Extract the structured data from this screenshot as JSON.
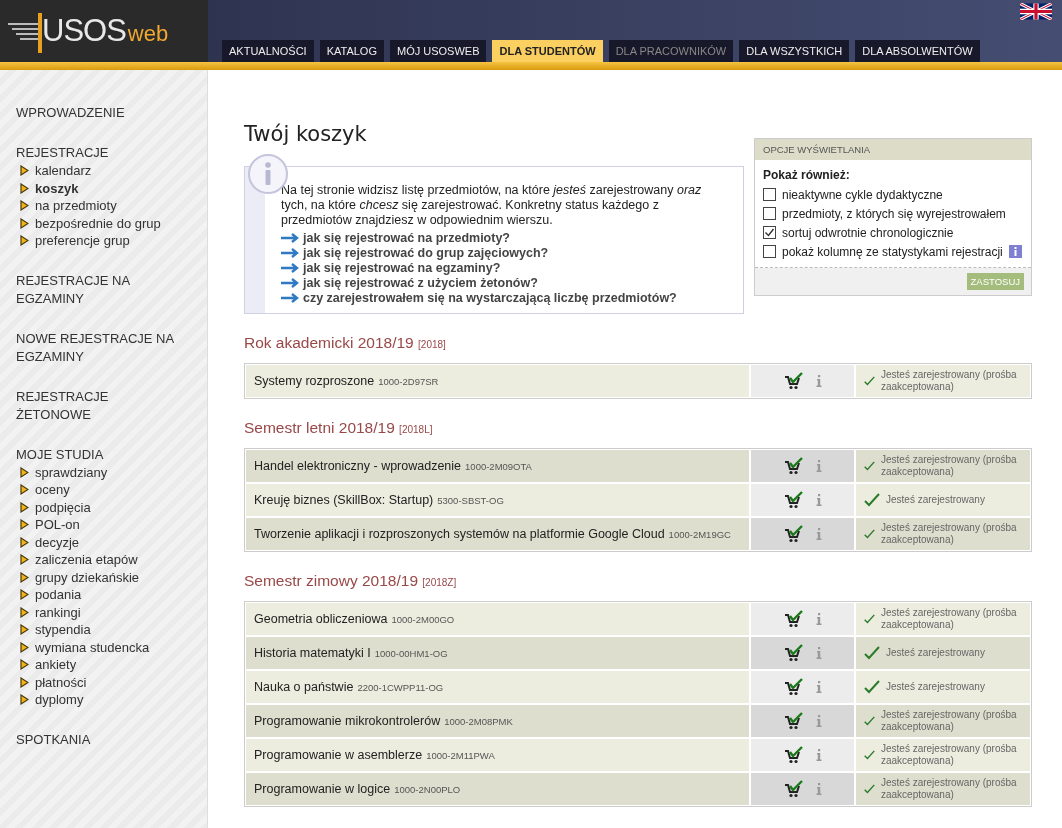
{
  "logo": {
    "main": "USOS",
    "suffix": "web"
  },
  "nav_tabs": [
    {
      "label": "AKTUALNOŚCI",
      "selected": false,
      "disabled": false
    },
    {
      "label": "KATALOG",
      "selected": false,
      "disabled": false
    },
    {
      "label": "MÓJ USOSWEB",
      "selected": false,
      "disabled": false
    },
    {
      "label": "DLA STUDENTÓW",
      "selected": true,
      "disabled": false
    },
    {
      "label": "DLA PRACOWNIKÓW",
      "selected": false,
      "disabled": true
    },
    {
      "label": "DLA WSZYSTKICH",
      "selected": false,
      "disabled": false
    },
    {
      "label": "DLA ABSOLWENTÓW",
      "selected": false,
      "disabled": false
    }
  ],
  "sidebar": [
    {
      "title": "WPROWADZENIE"
    },
    {
      "title": "REJESTRACJE",
      "items": [
        {
          "label": "kalendarz",
          "selected": false
        },
        {
          "label": "koszyk",
          "selected": true
        },
        {
          "label": "na przedmioty",
          "selected": false
        },
        {
          "label": "bezpośrednie do grup",
          "selected": false
        },
        {
          "label": "preferencje grup",
          "selected": false
        }
      ]
    },
    {
      "title": "REJESTRACJE NA EGZAMINY"
    },
    {
      "title": "NOWE REJESTRACJE NA EGZAMINY"
    },
    {
      "title": "REJESTRACJE ŻETONOWE"
    },
    {
      "title": "MOJE STUDIA",
      "items": [
        {
          "label": "sprawdziany",
          "selected": false
        },
        {
          "label": "oceny",
          "selected": false
        },
        {
          "label": "podpięcia",
          "selected": false
        },
        {
          "label": "POL-on",
          "selected": false
        },
        {
          "label": "decyzje",
          "selected": false
        },
        {
          "label": "zaliczenia etapów",
          "selected": false
        },
        {
          "label": "grupy dziekańskie",
          "selected": false
        },
        {
          "label": "podania",
          "selected": false
        },
        {
          "label": "rankingi",
          "selected": false
        },
        {
          "label": "stypendia",
          "selected": false
        },
        {
          "label": "wymiana studencka",
          "selected": false
        },
        {
          "label": "ankiety",
          "selected": false
        },
        {
          "label": "płatności",
          "selected": false
        },
        {
          "label": "dyplomy",
          "selected": false
        }
      ]
    },
    {
      "title": "SPOTKANIA"
    }
  ],
  "page_title": "Twój koszyk",
  "info_box": {
    "text": "Na tej stronie widzisz listę przedmiotów, na które *jesteś* zarejestrowany *oraz* tych, na które *chcesz* się zarejestrować. Konkretny status każdego z przedmiotów znajdziesz w odpowiednim wierszu.",
    "links": [
      "jak się rejestrować na przedmioty?",
      "jak się rejestrować do grup zajęciowych?",
      "jak się rejestrować na egzaminy?",
      "jak się rejestrować z użyciem żetonów?",
      "czy zarejestrowałem się na wystarczającą liczbę przedmiotów?"
    ]
  },
  "options": {
    "title": "OPCJE WYŚWIETLANIA",
    "heading": "Pokaż również:",
    "items": [
      {
        "label": "nieaktywne cykle dydaktyczne",
        "checked": false,
        "info": false
      },
      {
        "label": "przedmioty, z których się wyrejestrowałem",
        "checked": false,
        "info": false
      },
      {
        "label": "sortuj odwrotnie chronologicznie",
        "checked": true,
        "info": false
      },
      {
        "label": "pokaż kolumnę ze statystykami rejestracji",
        "checked": false,
        "info": true
      }
    ],
    "button": "ZASTOSUJ"
  },
  "groups": [
    {
      "title": "Rok akademicki 2018/19",
      "code": "[2018]",
      "rows": [
        {
          "name": "Systemy rozproszone",
          "code": "1000-2D97SR",
          "status": "Jesteś zarejestrowany (prośba zaakceptowana)"
        }
      ]
    },
    {
      "title": "Semestr letni 2018/19",
      "code": "[2018L]",
      "rows": [
        {
          "name": "Handel elektroniczny - wprowadzenie",
          "code": "1000-2M09OTA",
          "status": "Jesteś zarejestrowany (prośba zaakceptowana)"
        },
        {
          "name": "Kreuję biznes (SkillBox: Startup)",
          "code": "5300-SBST-OG",
          "status": "Jesteś zarejestrowany"
        },
        {
          "name": "Tworzenie aplikacji i rozproszonych systemów na platformie Google Cloud",
          "code": "1000-2M19GC",
          "status": "Jesteś zarejestrowany (prośba zaakceptowana)"
        }
      ]
    },
    {
      "title": "Semestr zimowy 2018/19",
      "code": "[2018Z]",
      "rows": [
        {
          "name": "Geometria obliczeniowa",
          "code": "1000-2M00GO",
          "status": "Jesteś zarejestrowany (prośba zaakceptowana)"
        },
        {
          "name": "Historia matematyki I",
          "code": "1000-00HM1-OG",
          "status": "Jesteś zarejestrowany"
        },
        {
          "name": "Nauka o państwie",
          "code": "2200-1CWPP11-OG",
          "status": "Jesteś zarejestrowany"
        },
        {
          "name": "Programowanie mikrokontrolerów",
          "code": "1000-2M08PMK",
          "status": "Jesteś zarejestrowany (prośba zaakceptowana)"
        },
        {
          "name": "Programowanie w asemblerze",
          "code": "1000-2M11PWA",
          "status": "Jesteś zarejestrowany (prośba zaakceptowana)"
        },
        {
          "name": "Programowanie w logice",
          "code": "1000-2N00PLO",
          "status": "Jesteś zarejestrowany (prośba zaakceptowana)"
        }
      ]
    }
  ]
}
